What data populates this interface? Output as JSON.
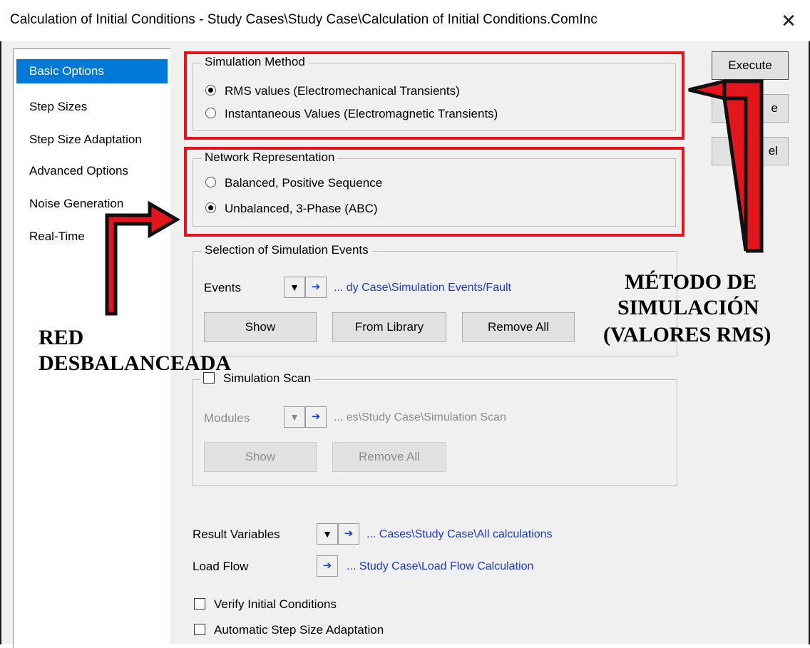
{
  "window": {
    "title": "Calculation of Initial Conditions - Study Cases\\Study Case\\Calculation of Initial Conditions.ComInc",
    "close_glyph": "✕"
  },
  "nav": {
    "items": [
      {
        "label": "Basic Options",
        "selected": true
      },
      {
        "label": "Step Sizes"
      },
      {
        "label": "Step Size Adaptation"
      },
      {
        "label": "Advanced Options"
      },
      {
        "label": "Noise Generation"
      },
      {
        "label": "Real-Time"
      }
    ]
  },
  "buttons": {
    "execute": "Execute",
    "close": "Close",
    "cancel": "Cancel",
    "close_visible": "e",
    "cancel_left": "C",
    "cancel_right": "el"
  },
  "simulation_method": {
    "title": "Simulation Method",
    "options": [
      {
        "label": "RMS values (Electromechanical Transients)",
        "checked": true
      },
      {
        "label": "Instantaneous Values (Electromagnetic Transients)",
        "checked": false
      }
    ]
  },
  "network_representation": {
    "title": "Network Representation",
    "options": [
      {
        "label": "Balanced, Positive Sequence",
        "checked": false
      },
      {
        "label": "Unbalanced, 3-Phase (ABC)",
        "checked": true
      }
    ]
  },
  "events": {
    "title": "Selection of Simulation Events",
    "label": "Events",
    "ref": "... dy Case\\Simulation Events/Fault",
    "show": "Show",
    "from_library": "From Library",
    "remove_all": "Remove All"
  },
  "scan": {
    "title": "Simulation Scan",
    "checked": false,
    "label": "Modules",
    "ref": "... es\\Study Case\\Simulation Scan",
    "show": "Show",
    "remove_all": "Remove All"
  },
  "result_variables": {
    "label": "Result Variables",
    "ref": "... Cases\\Study Case\\All calculations"
  },
  "load_flow": {
    "label": "Load Flow",
    "ref": "... Study Case\\Load Flow Calculation"
  },
  "checkboxes": [
    {
      "label": "Verify Initial Conditions",
      "checked": false
    },
    {
      "label": "Automatic Step Size Adaptation",
      "checked": false
    }
  ],
  "icons": {
    "dropdown": "▼",
    "jump": "➔"
  },
  "annotations": {
    "left": [
      "RED",
      "DESBALANCEADA"
    ],
    "right": [
      "MÉTODO DE",
      "SIMULACIÓN",
      "(VALORES RMS)"
    ],
    "highlight_color": "#e3161d"
  }
}
